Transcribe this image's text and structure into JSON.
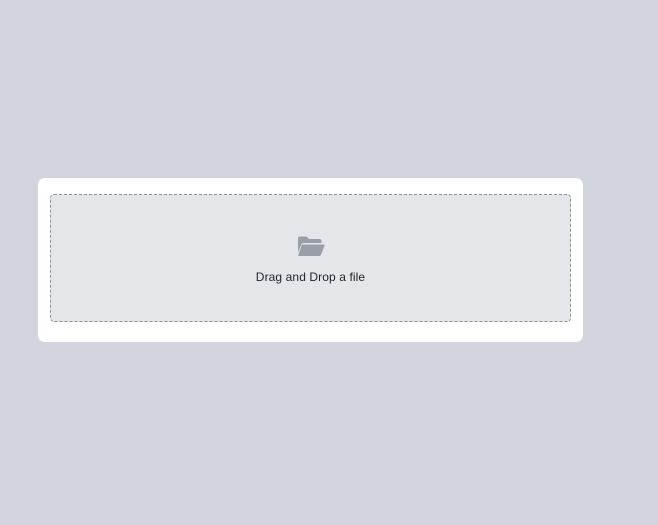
{
  "upload": {
    "icon": "open-folder-icon",
    "label": "Drag and Drop a file"
  },
  "colors": {
    "page_background": "#d2d5dd",
    "card_background": "#ffffff",
    "dropzone_background": "#e4e6ea",
    "dropzone_border": "#8e939c",
    "icon_color": "#9a9ea8"
  }
}
